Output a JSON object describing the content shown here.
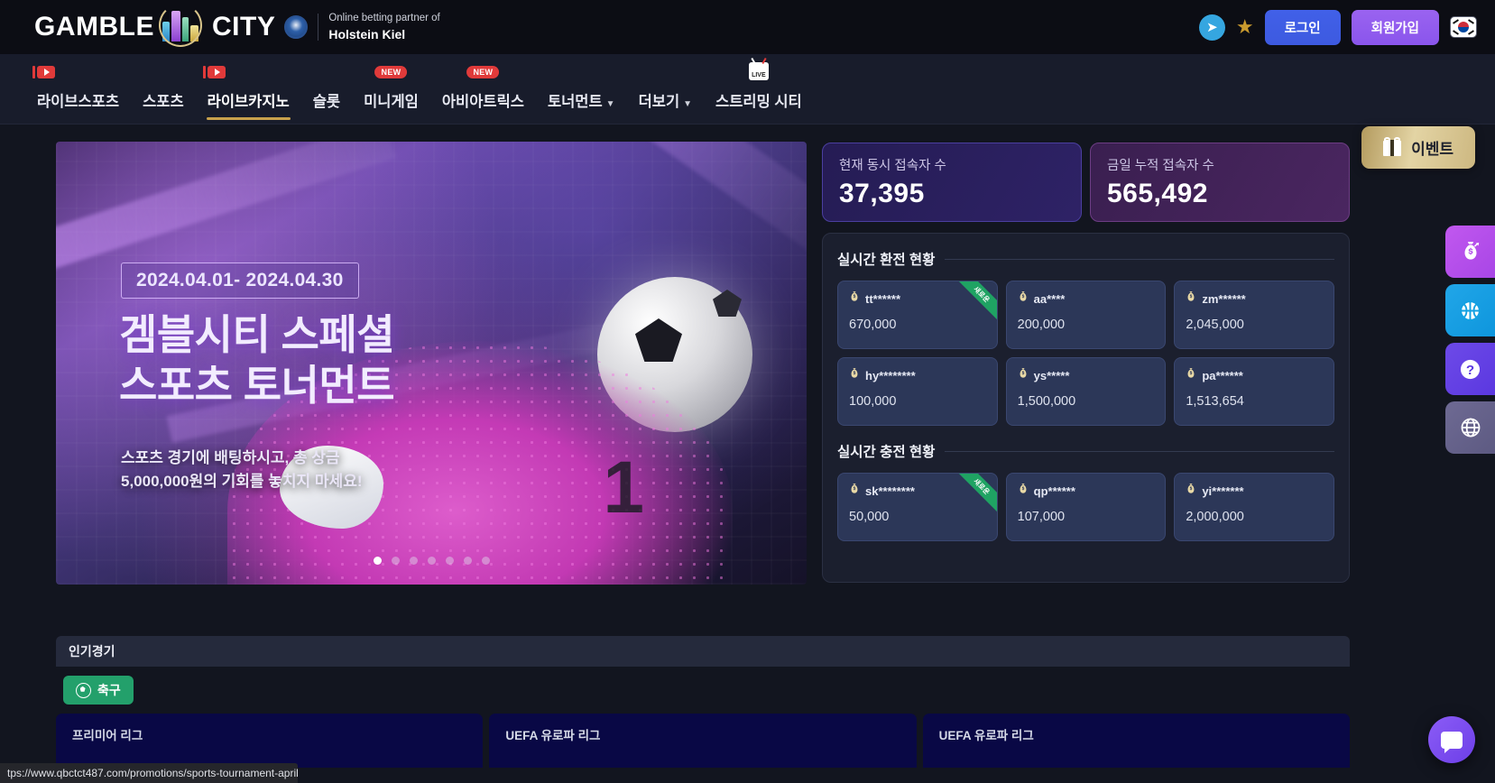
{
  "brand": {
    "logo_left": "GAMBLE",
    "logo_right": "CITY",
    "partner_line1": "Online betting partner of",
    "partner_line2": "Holstein Kiel",
    "club_badge_icon": "holstein-kiel-crest-icon"
  },
  "topbar": {
    "telegram_icon": "telegram-icon",
    "star_icon": "star-icon",
    "login_label": "로그인",
    "signup_label": "회원가입",
    "language_flag": "south-korea-flag-icon"
  },
  "nav": {
    "items": [
      {
        "label": "라이브스포츠",
        "badge": "youtube",
        "active": false,
        "caret": false
      },
      {
        "label": "스포츠",
        "badge": "",
        "active": false,
        "caret": false
      },
      {
        "label": "라이브카지노",
        "badge": "youtube",
        "active": true,
        "caret": false
      },
      {
        "label": "슬롯",
        "badge": "",
        "active": false,
        "caret": false
      },
      {
        "label": "미니게임",
        "badge": "NEW",
        "active": false,
        "caret": false
      },
      {
        "label": "아비아트릭스",
        "badge": "NEW",
        "active": false,
        "caret": false
      },
      {
        "label": "토너먼트",
        "badge": "",
        "active": false,
        "caret": true
      },
      {
        "label": "더보기",
        "badge": "",
        "active": false,
        "caret": true
      },
      {
        "label": "스트리밍 시티",
        "badge": "LIVE",
        "active": false,
        "caret": false
      }
    ],
    "event_button": {
      "label": "이벤트",
      "icon": "gift-icon"
    }
  },
  "hero": {
    "date_range": "2024.04.01- 2024.04.30",
    "title_line1": "겜블시티 스페셜",
    "title_line2": "스포츠 토너먼트",
    "subtitle_line1": "스포츠 경기에 배팅하시고, 총 상금",
    "subtitle_line2": "5,000,000원의 기회를 놓치지 마세요!",
    "jersey_number": "1",
    "dots_total": 7,
    "dots_active_index": 0
  },
  "stats": [
    {
      "label": "현재 동시 접속자 수",
      "value": "37,395"
    },
    {
      "label": "금일 누적 접속자 수",
      "value": "565,492"
    }
  ],
  "live_panel": {
    "exchange_title": "실시간 환전 현황",
    "charge_title": "실시간 충전 현황",
    "new_badge": "새로운",
    "money_icon": "money-bag-icon",
    "exchange_items": [
      {
        "user": "tt******",
        "amount": "670,000",
        "is_new": true
      },
      {
        "user": "aa****",
        "amount": "200,000",
        "is_new": false
      },
      {
        "user": "zm******",
        "amount": "2,045,000",
        "is_new": false
      },
      {
        "user": "hy********",
        "amount": "100,000",
        "is_new": false
      },
      {
        "user": "ys*****",
        "amount": "1,500,000",
        "is_new": false
      },
      {
        "user": "pa******",
        "amount": "1,513,654",
        "is_new": false
      }
    ],
    "charge_items": [
      {
        "user": "sk********",
        "amount": "50,000",
        "is_new": true
      },
      {
        "user": "qp******",
        "amount": "107,000",
        "is_new": false
      },
      {
        "user": "yi*******",
        "amount": "2,000,000",
        "is_new": false
      }
    ]
  },
  "side_rail": [
    {
      "name": "money-bag-arrow-icon",
      "glyph": "💰",
      "color": "#b84be8"
    },
    {
      "name": "basketball-icon",
      "glyph": "🏀",
      "color": "#13a0e2"
    },
    {
      "name": "question-mark-icon",
      "glyph": "?",
      "color": "#6240e4"
    },
    {
      "name": "globe-icon",
      "glyph": "🌐",
      "color": "#64608a"
    }
  ],
  "popular": {
    "title": "인기경기",
    "sport_tab": {
      "label": "축구",
      "icon": "soccer-ball-icon"
    },
    "matches": [
      {
        "league": "프리미어 리그"
      },
      {
        "league": "UEFA 유로파 리그"
      },
      {
        "league": "UEFA 유로파 리그"
      }
    ]
  },
  "statusbar": {
    "url": "tps://www.qbctct487.com/promotions/sports-tournament-april"
  },
  "chat": {
    "icon": "chat-bubble-icon"
  },
  "colors": {
    "page_bg": "#12151f",
    "topbar_bg": "#0c0d14",
    "nav_bg": "#181c2b",
    "accent_gold": "#c8a14c",
    "login_blue": "#3d5ae0",
    "signup_purple": "#8a55ec",
    "new_green": "#1fa363",
    "soccer_green": "#23a06b",
    "match_navy": "#090845"
  }
}
